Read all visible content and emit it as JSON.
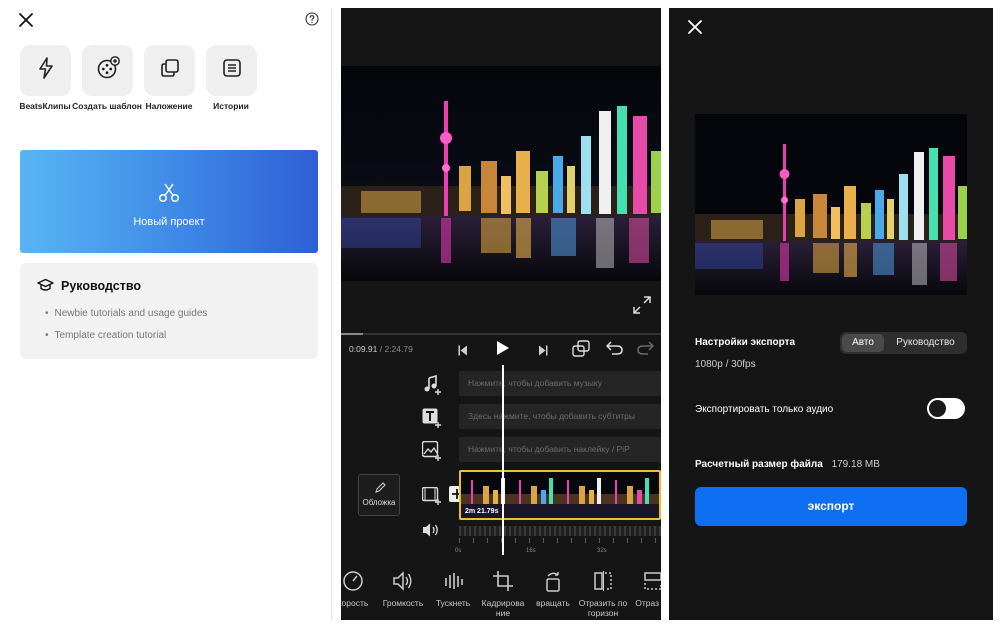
{
  "home": {
    "quick_actions": [
      {
        "label": "BeatsКлипы",
        "icon": "lightning-icon"
      },
      {
        "label": "Создать шаблон",
        "icon": "film-reel-plus-icon"
      },
      {
        "label": "Наложение",
        "icon": "overlay-icon"
      },
      {
        "label": "Истории",
        "icon": "list-icon"
      }
    ],
    "new_project_label": "Новый проект",
    "guide": {
      "title": "Руководство",
      "items": [
        "Newbie tutorials and usage guides",
        "Template creation tutorial"
      ]
    }
  },
  "editor": {
    "time_current": "0:09.91",
    "time_total": "2:24.79",
    "tracks": {
      "music_placeholder": "Нажмите, чтобы добавить музыку",
      "subtitle_placeholder": "Здесь нажмите, чтобы добавить субтитры",
      "sticker_placeholder": "Нажмите, чтобы добавить наклейку / PiP"
    },
    "cover_label": "Обложка",
    "clip_duration": "2m 21.79s",
    "ruler_ticks": [
      "0s",
      "16s",
      "32s"
    ],
    "tools": [
      {
        "label": "корость",
        "icon": "speed-icon"
      },
      {
        "label": "Громкость",
        "icon": "volume-icon"
      },
      {
        "label": "Тускнеть",
        "icon": "fade-icon"
      },
      {
        "label": "Кадрирова ние",
        "icon": "crop-icon"
      },
      {
        "label": "вращать",
        "icon": "rotate-icon"
      },
      {
        "label": "Отразить по горизон",
        "icon": "flip-horizontal-icon"
      },
      {
        "label": "Отраз по",
        "icon": "flip-vertical-icon"
      }
    ]
  },
  "export": {
    "settings_label": "Настройки экспорта",
    "mode_auto": "Авто",
    "mode_manual": "Руководство",
    "resolution": "1080p / 30fps",
    "audio_only_label": "Экспортировать только аудио",
    "audio_only_enabled": false,
    "file_size_label": "Расчетный размер файла",
    "file_size_value": "179.18 MB",
    "export_button": "экспорт"
  },
  "colors": {
    "accent_blue": "#0f6ff2",
    "gradient_start": "#5ab5f3",
    "gradient_end": "#2f5fd6",
    "timeline_clip_border": "#e9c41f"
  }
}
